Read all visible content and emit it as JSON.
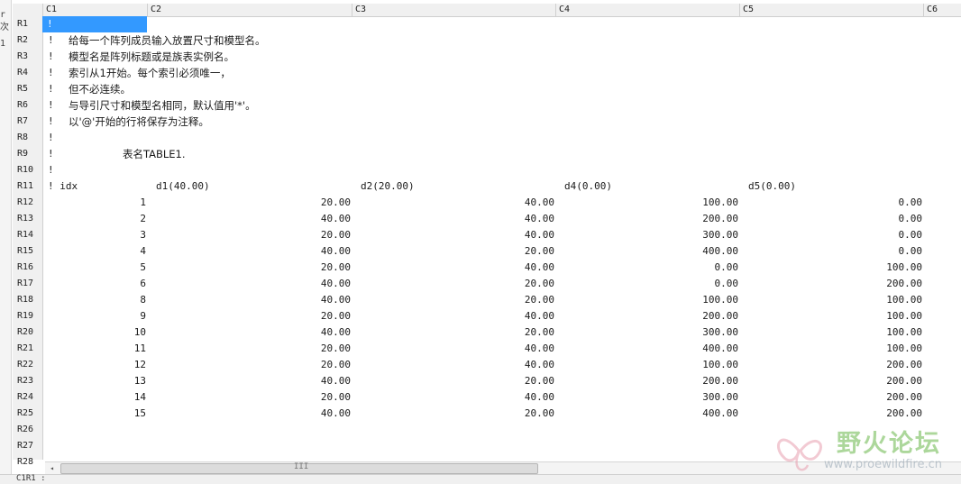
{
  "left_edge": [
    "r",
    "次",
    "1"
  ],
  "columns": [
    "C1",
    "C2",
    "C3",
    "C4",
    "C5",
    "C6"
  ],
  "row_labels": [
    "R1",
    "R2",
    "R3",
    "R4",
    "R5",
    "R6",
    "R7",
    "R8",
    "R9",
    "R10",
    "R11",
    "R12",
    "R13",
    "R14",
    "R15",
    "R16",
    "R17",
    "R18",
    "R19",
    "R20",
    "R21",
    "R22",
    "R23",
    "R24",
    "R25",
    "R26",
    "R27",
    "R28"
  ],
  "selected_cell": {
    "value": "!"
  },
  "comment_lines": [
    {
      "mark": "!",
      "text": "给每一个阵列成员输入放置尺寸和模型名。"
    },
    {
      "mark": "!",
      "text": "模型名是阵列标题或是族表实例名。"
    },
    {
      "mark": "!",
      "text": "索引从1开始。每个索引必须唯一，"
    },
    {
      "mark": "!",
      "text": "但不必连续。"
    },
    {
      "mark": "!",
      "text": "与导引尺寸和模型名相同，默认值用'*'。"
    },
    {
      "mark": "!",
      "text": "以'@'开始的行将保存为注释。"
    },
    {
      "mark": "!",
      "text": ""
    },
    {
      "mark": "!",
      "text": "表名TABLE1."
    },
    {
      "mark": "!",
      "text": ""
    }
  ],
  "header_row": {
    "c1": "! idx",
    "c2": "d1(40.00)",
    "c3": "d2(20.00)",
    "c4": "d4(0.00)",
    "c5": "d5(0.00)"
  },
  "table": [
    [
      "1",
      "20.00",
      "40.00",
      "100.00",
      "0.00"
    ],
    [
      "2",
      "40.00",
      "40.00",
      "200.00",
      "0.00"
    ],
    [
      "3",
      "20.00",
      "40.00",
      "300.00",
      "0.00"
    ],
    [
      "4",
      "40.00",
      "20.00",
      "400.00",
      "0.00"
    ],
    [
      "5",
      "20.00",
      "40.00",
      "0.00",
      "100.00"
    ],
    [
      "6",
      "40.00",
      "20.00",
      "0.00",
      "200.00"
    ],
    [
      "8",
      "40.00",
      "20.00",
      "100.00",
      "100.00"
    ],
    [
      "9",
      "20.00",
      "40.00",
      "200.00",
      "100.00"
    ],
    [
      "10",
      "40.00",
      "20.00",
      "300.00",
      "100.00"
    ],
    [
      "11",
      "20.00",
      "40.00",
      "400.00",
      "100.00"
    ],
    [
      "12",
      "20.00",
      "40.00",
      "100.00",
      "200.00"
    ],
    [
      "13",
      "40.00",
      "20.00",
      "200.00",
      "200.00"
    ],
    [
      "14",
      "20.00",
      "40.00",
      "300.00",
      "200.00"
    ],
    [
      "15",
      "40.00",
      "20.00",
      "400.00",
      "200.00"
    ]
  ],
  "scrollbar": {
    "left_arrow": "◂",
    "grip": "III"
  },
  "status": {
    "text": "C1R1 :"
  },
  "watermark": {
    "title": "野火论坛",
    "url": "www.proewildfire.cn"
  }
}
